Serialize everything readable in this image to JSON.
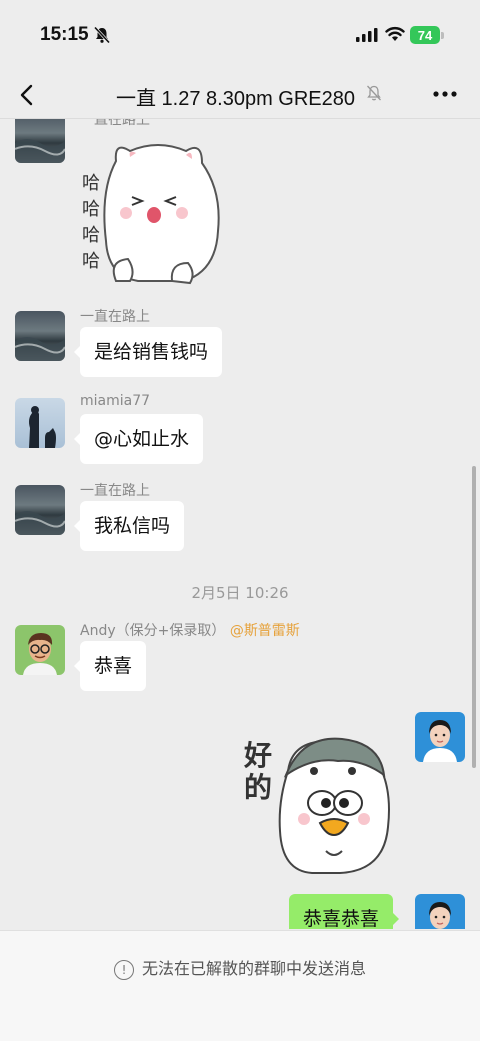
{
  "status_bar": {
    "time": "15:15",
    "battery": "74"
  },
  "nav": {
    "title": "一直 1.27 8.30pm GRE280"
  },
  "messages": {
    "m1": {
      "sender": "一直在路上",
      "sticker_text": [
        "哈",
        "哈",
        "哈",
        "哈"
      ]
    },
    "m2": {
      "sender": "一直在路上",
      "text": "是给销售钱吗"
    },
    "m3": {
      "sender": "miamia77",
      "text": "@心如止水"
    },
    "m4": {
      "sender": "一直在路上",
      "text": "我私信吗"
    },
    "timestamp": "2月5日 10:26",
    "m5": {
      "sender": "Andy（保分+保录取）",
      "mention": "@斯普雷斯",
      "text": "恭喜"
    },
    "m6": {
      "sticker_text": "好的"
    },
    "m7": {
      "text": "恭喜恭喜"
    }
  },
  "footer": {
    "notice": "无法在已解散的群聊中发送消息"
  }
}
